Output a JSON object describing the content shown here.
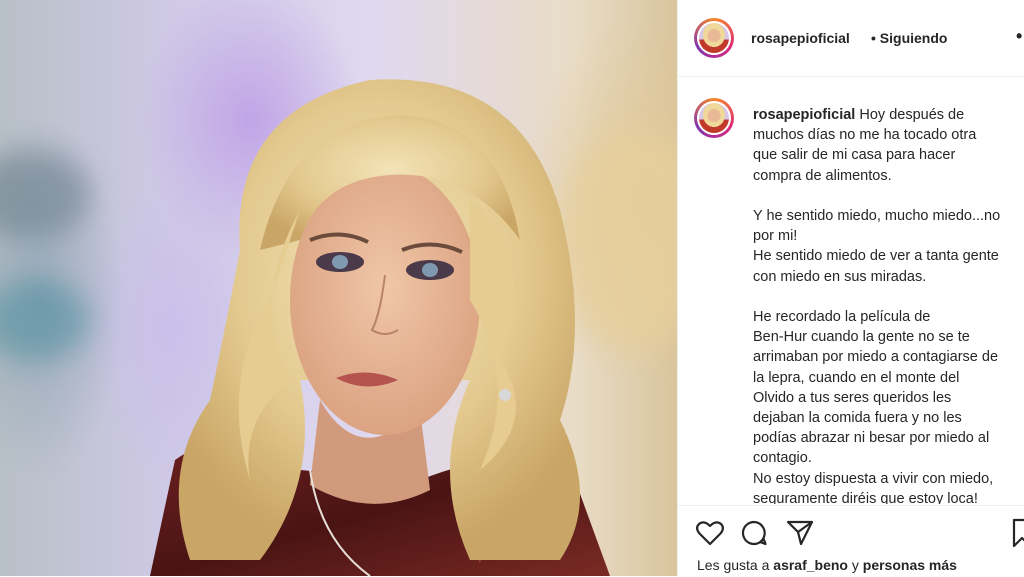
{
  "post": {
    "username": "rosapepioficial",
    "separator": "•",
    "follow_status": "Siguiendo",
    "more_glyph": "•",
    "caption": "Hoy después de\nmuchos días no me ha tocado otra\nque salir de mi casa para hacer\ncompra de alimentos.\n\nY he sentido miedo, mucho miedo...no\npor mi!\nHe sentido miedo de ver a tanta gente\ncon miedo en sus miradas.\n\nHe recordado la película de\nBen-Hur cuando la gente no se te\narrimaban por miedo a contagiarse de\nla lepra, cuando en el monte del\nOlvido a tus seres queridos les\ndejaban la comida fuera y no les\npodías abrazar ni besar por miedo al\ncontagio.\nNo estoy dispuesta a vivir con miedo,\nseguramente diréis que estoy loca!",
    "likes_prefix": "Les gusta a",
    "likes_user": "asraf_beno",
    "likes_connector": "y",
    "likes_suffix": "personas más"
  },
  "icons": {
    "like": "heart-icon",
    "comment": "comment-icon",
    "share": "share-icon",
    "save": "bookmark-icon",
    "more": "more-icon"
  },
  "colors": {
    "text": "#262626",
    "border": "#efefef",
    "story_ring": [
      "#f58529",
      "#dd2a7b",
      "#8134af"
    ]
  }
}
